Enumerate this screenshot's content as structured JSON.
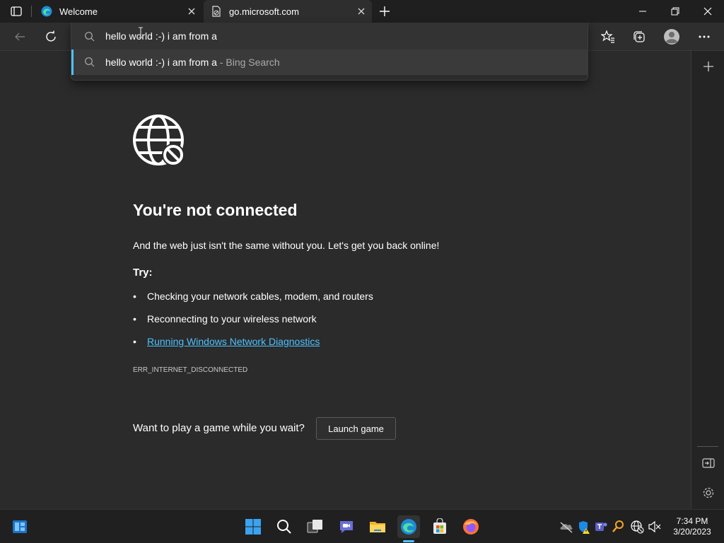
{
  "browser": {
    "tabs": [
      {
        "label": "Welcome"
      },
      {
        "label": "go.microsoft.com"
      }
    ]
  },
  "omnibox": {
    "query": "hello world :-) i am from a",
    "suggestion": {
      "text": "hello world :-) i am from a",
      "suffix": " - Bing Search"
    }
  },
  "error_page": {
    "title": "You're not connected",
    "subtitle": "And the web just isn't the same without you. Let's get you back online!",
    "try_label": "Try:",
    "bullets": [
      "Checking your network cables, modem, and routers",
      "Reconnecting to your wireless network",
      "Running Windows Network Diagnostics"
    ],
    "error_code": "ERR_INTERNET_DISCONNECTED",
    "game_prompt": "Want to play a game while you wait?",
    "launch_button": "Launch game",
    "bullet_char": "•"
  },
  "taskbar": {
    "time": "7:34 PM",
    "date": "3/20/2023"
  },
  "colors": {
    "accent_link": "#4cc2ff",
    "background": "#2b2b2b",
    "taskbar": "#202020"
  }
}
